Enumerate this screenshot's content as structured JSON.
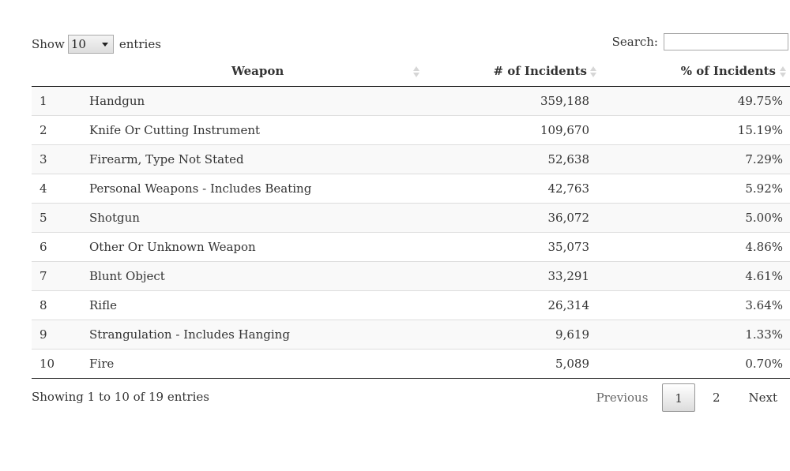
{
  "length": {
    "show_label": "Show",
    "selected": "10",
    "entries_label": "entries"
  },
  "search": {
    "label": "Search:",
    "value": "",
    "placeholder": ""
  },
  "table": {
    "columns": [
      "",
      "Weapon",
      "# of Incidents",
      "% of Incidents"
    ],
    "rows": [
      {
        "idx": "1",
        "weapon": "Handgun",
        "incidents": "359,188",
        "pct": "49.75%"
      },
      {
        "idx": "2",
        "weapon": "Knife Or Cutting Instrument",
        "incidents": "109,670",
        "pct": "15.19%"
      },
      {
        "idx": "3",
        "weapon": "Firearm, Type Not Stated",
        "incidents": "52,638",
        "pct": "7.29%"
      },
      {
        "idx": "4",
        "weapon": "Personal Weapons - Includes Beating",
        "incidents": "42,763",
        "pct": "5.92%"
      },
      {
        "idx": "5",
        "weapon": "Shotgun",
        "incidents": "36,072",
        "pct": "5.00%"
      },
      {
        "idx": "6",
        "weapon": "Other Or Unknown Weapon",
        "incidents": "35,073",
        "pct": "4.86%"
      },
      {
        "idx": "7",
        "weapon": "Blunt Object",
        "incidents": "33,291",
        "pct": "4.61%"
      },
      {
        "idx": "8",
        "weapon": "Rifle",
        "incidents": "26,314",
        "pct": "3.64%"
      },
      {
        "idx": "9",
        "weapon": "Strangulation - Includes Hanging",
        "incidents": "9,619",
        "pct": "1.33%"
      },
      {
        "idx": "10",
        "weapon": "Fire",
        "incidents": "5,089",
        "pct": "0.70%"
      }
    ]
  },
  "info": "Showing 1 to 10 of 19 entries",
  "pagination": {
    "previous": "Previous",
    "pages": [
      "1",
      "2"
    ],
    "current": "1",
    "next": "Next"
  },
  "colors": {
    "row_stripe": "#f9f9f9",
    "border_dark": "#111111",
    "sort_icon": "#d6d6d6"
  }
}
